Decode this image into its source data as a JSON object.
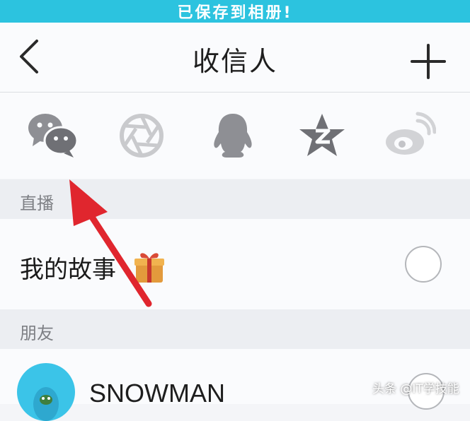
{
  "banner": {
    "text": "已保存到相册!"
  },
  "header": {
    "title": "收信人",
    "back_icon": "back-chevron-icon",
    "add_icon": "plus-icon"
  },
  "share_targets": [
    {
      "icon": "wechat-icon"
    },
    {
      "icon": "moments-icon"
    },
    {
      "icon": "qq-icon"
    },
    {
      "icon": "qzone-icon"
    },
    {
      "icon": "weibo-icon"
    }
  ],
  "sections": {
    "live": {
      "header": "直播",
      "story": {
        "label": "我的故事",
        "icon": "gift-icon",
        "selected": false
      }
    },
    "friends": {
      "header": "朋友",
      "items": [
        {
          "name": "SNOWMAN",
          "selected": false
        }
      ]
    }
  },
  "annotation": {
    "color": "#e0262e"
  },
  "watermark": {
    "text": "头条 @IT学技能"
  },
  "colors": {
    "banner": "#2cc3df",
    "section_bg": "#eceef2",
    "row_bg": "#fafbfd"
  }
}
